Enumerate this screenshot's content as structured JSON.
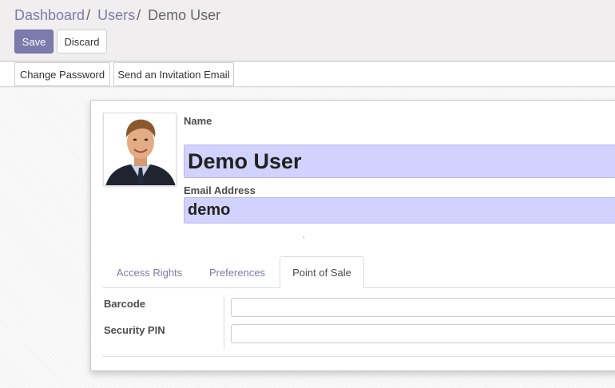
{
  "breadcrumb": {
    "items": [
      "Dashboard",
      "Users"
    ],
    "separator": "/",
    "current": "Demo User"
  },
  "toolbar": {
    "save_label": "Save",
    "discard_label": "Discard"
  },
  "header_buttons": {
    "change_password": "Change Password",
    "send_invitation": "Send an Invitation Email"
  },
  "form": {
    "name_label": "Name",
    "name_value": "Demo User",
    "email_label": "Email Address",
    "email_value": "demo"
  },
  "tabs": [
    {
      "label": "Access Rights",
      "active": false
    },
    {
      "label": "Preferences",
      "active": false
    },
    {
      "label": "Point of Sale",
      "active": true
    }
  ],
  "pos_fields": {
    "barcode_label": "Barcode",
    "barcode_value": "",
    "pin_label": "Security PIN",
    "pin_value": ""
  },
  "colors": {
    "accent": "#7c7bad",
    "required_field_bg": "#d2d2ff"
  },
  "icons": {
    "avatar": "user-avatar-photo"
  }
}
